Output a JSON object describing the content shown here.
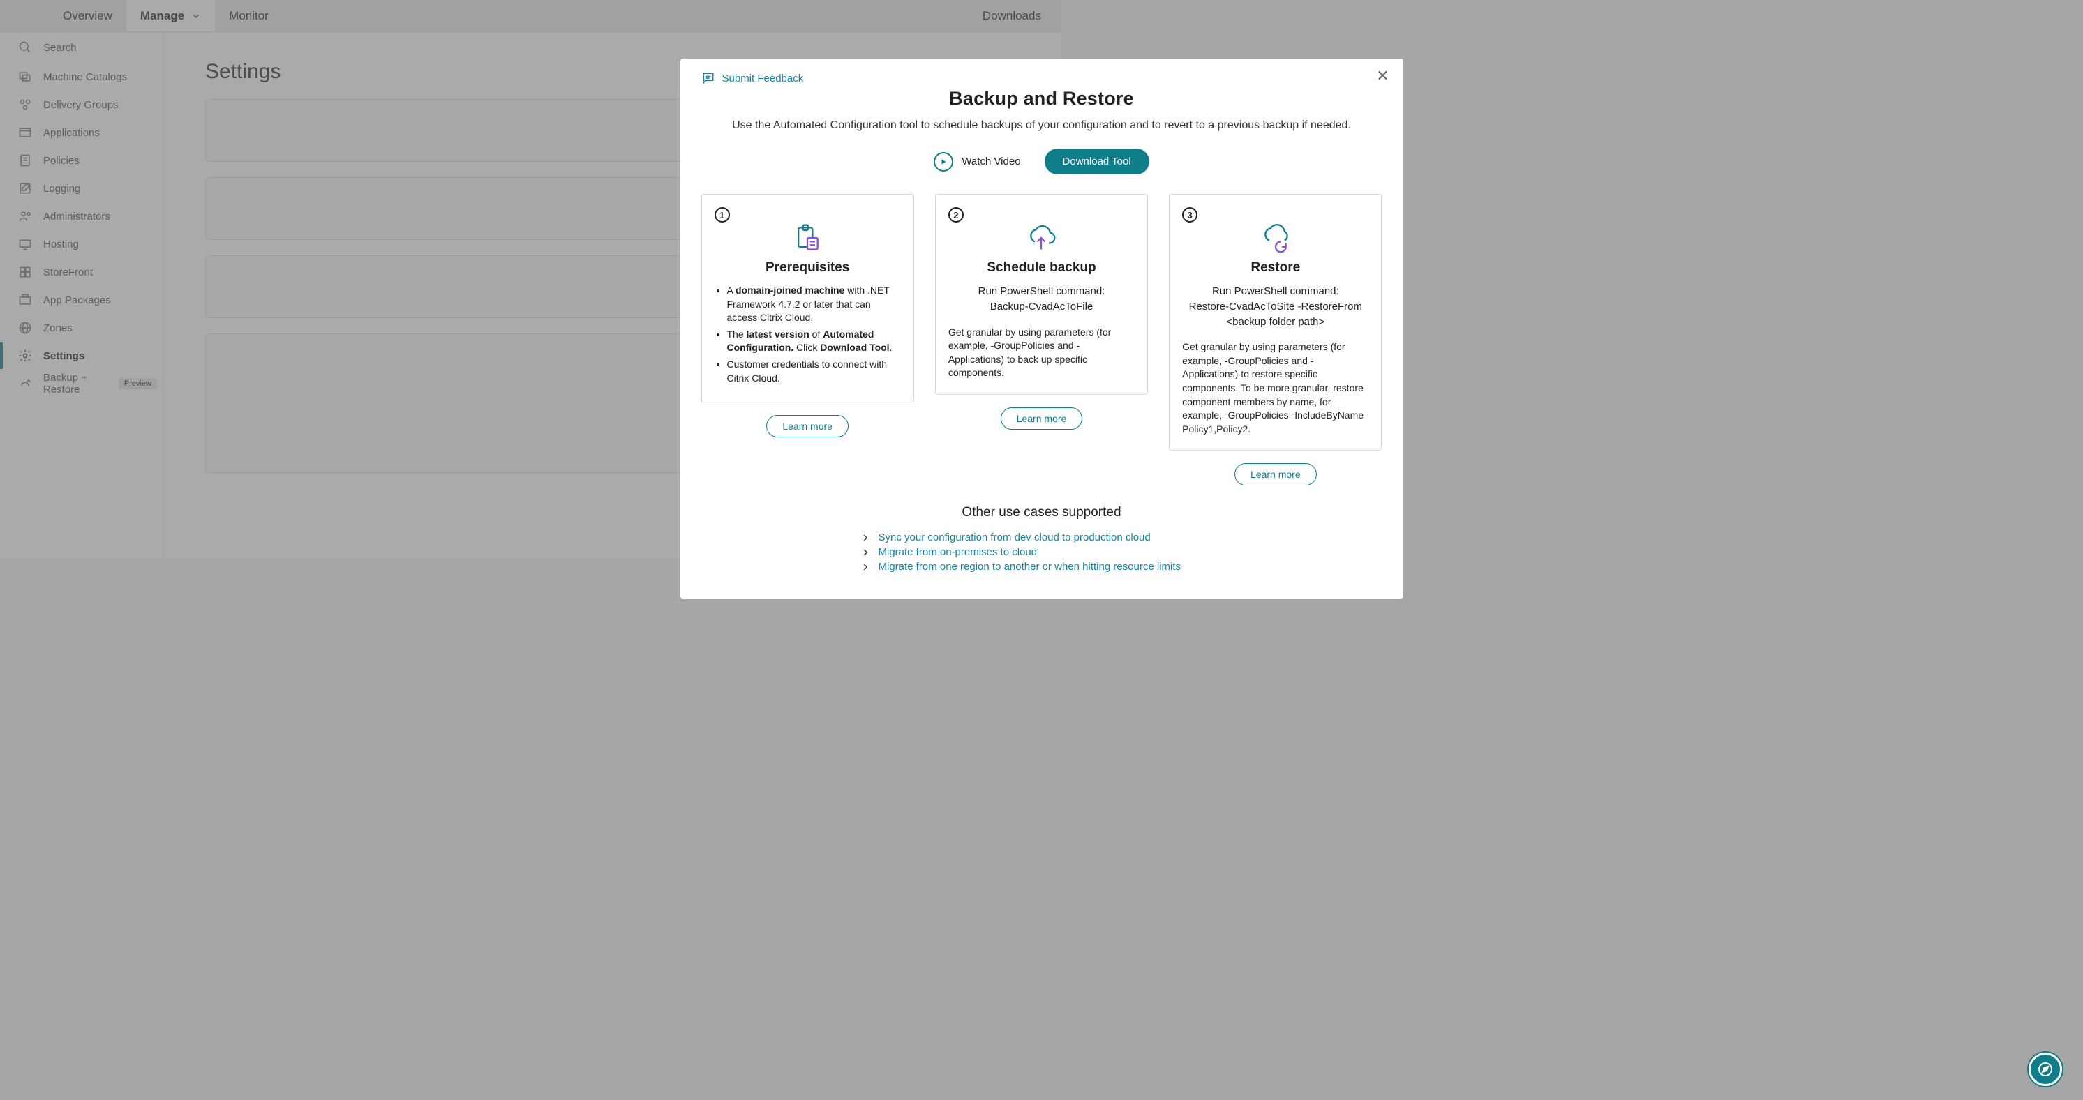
{
  "topnav": {
    "tabs": [
      "Overview",
      "Manage",
      "Monitor"
    ],
    "activeTab": "Manage",
    "downloads": "Downloads"
  },
  "sidebar": {
    "items": [
      {
        "name": "search",
        "label": "Search"
      },
      {
        "name": "machine-catalogs",
        "label": "Machine Catalogs"
      },
      {
        "name": "delivery-groups",
        "label": "Delivery Groups"
      },
      {
        "name": "applications",
        "label": "Applications"
      },
      {
        "name": "policies",
        "label": "Policies"
      },
      {
        "name": "logging",
        "label": "Logging"
      },
      {
        "name": "administrators",
        "label": "Administrators"
      },
      {
        "name": "hosting",
        "label": "Hosting"
      },
      {
        "name": "storefront",
        "label": "StoreFront"
      },
      {
        "name": "app-packages",
        "label": "App Packages"
      },
      {
        "name": "zones",
        "label": "Zones"
      },
      {
        "name": "settings",
        "label": "Settings"
      },
      {
        "name": "backup-restore",
        "label": "Backup + Restore",
        "pill": "Preview"
      }
    ],
    "active": "settings"
  },
  "page": {
    "title": "Settings"
  },
  "modal": {
    "feedback": "Submit Feedback",
    "title": "Backup and Restore",
    "subtitle": "Use the Automated Configuration tool to schedule backups of your configuration and to revert to a previous backup if needed.",
    "watch": "Watch Video",
    "download": "Download Tool",
    "otherTitle": "Other use cases supported",
    "learnMore": "Learn more"
  },
  "cards": [
    {
      "num": "1",
      "title": "Prerequisites",
      "bullets": [
        {
          "pre": "A ",
          "b1": "domain-joined machine",
          "mid": " with .NET Framework 4.7.2 or later that can access Citrix Cloud."
        },
        {
          "pre": "The ",
          "b1": "latest version",
          "mid": " of ",
          "b2": "Automated Configuration.",
          "post": " Click ",
          "b3": "Download Tool",
          "end": "."
        },
        {
          "pre": "Customer credentials to connect with Citrix Cloud."
        }
      ]
    },
    {
      "num": "2",
      "title": "Schedule backup",
      "cmdLabel": "Run PowerShell command:",
      "cmd": "Backup-CvadAcToFile",
      "desc": "Get granular by using parameters (for example, -GroupPolicies and -Applications) to back up specific components."
    },
    {
      "num": "3",
      "title": "Restore",
      "cmdLabel": "Run PowerShell command:",
      "cmd": "Restore-CvadAcToSite -RestoreFrom <backup folder path>",
      "desc": "Get granular by using parameters (for example, -GroupPolicies and -Applications) to restore specific components. To be more granular, restore component members by name, for example, -GroupPolicies -IncludeByName Policy1,Policy2."
    }
  ],
  "usecases": [
    "Sync your configuration from dev cloud to production cloud",
    "Migrate from on-premises to cloud",
    "Migrate from one region to another or when hitting resource limits"
  ]
}
